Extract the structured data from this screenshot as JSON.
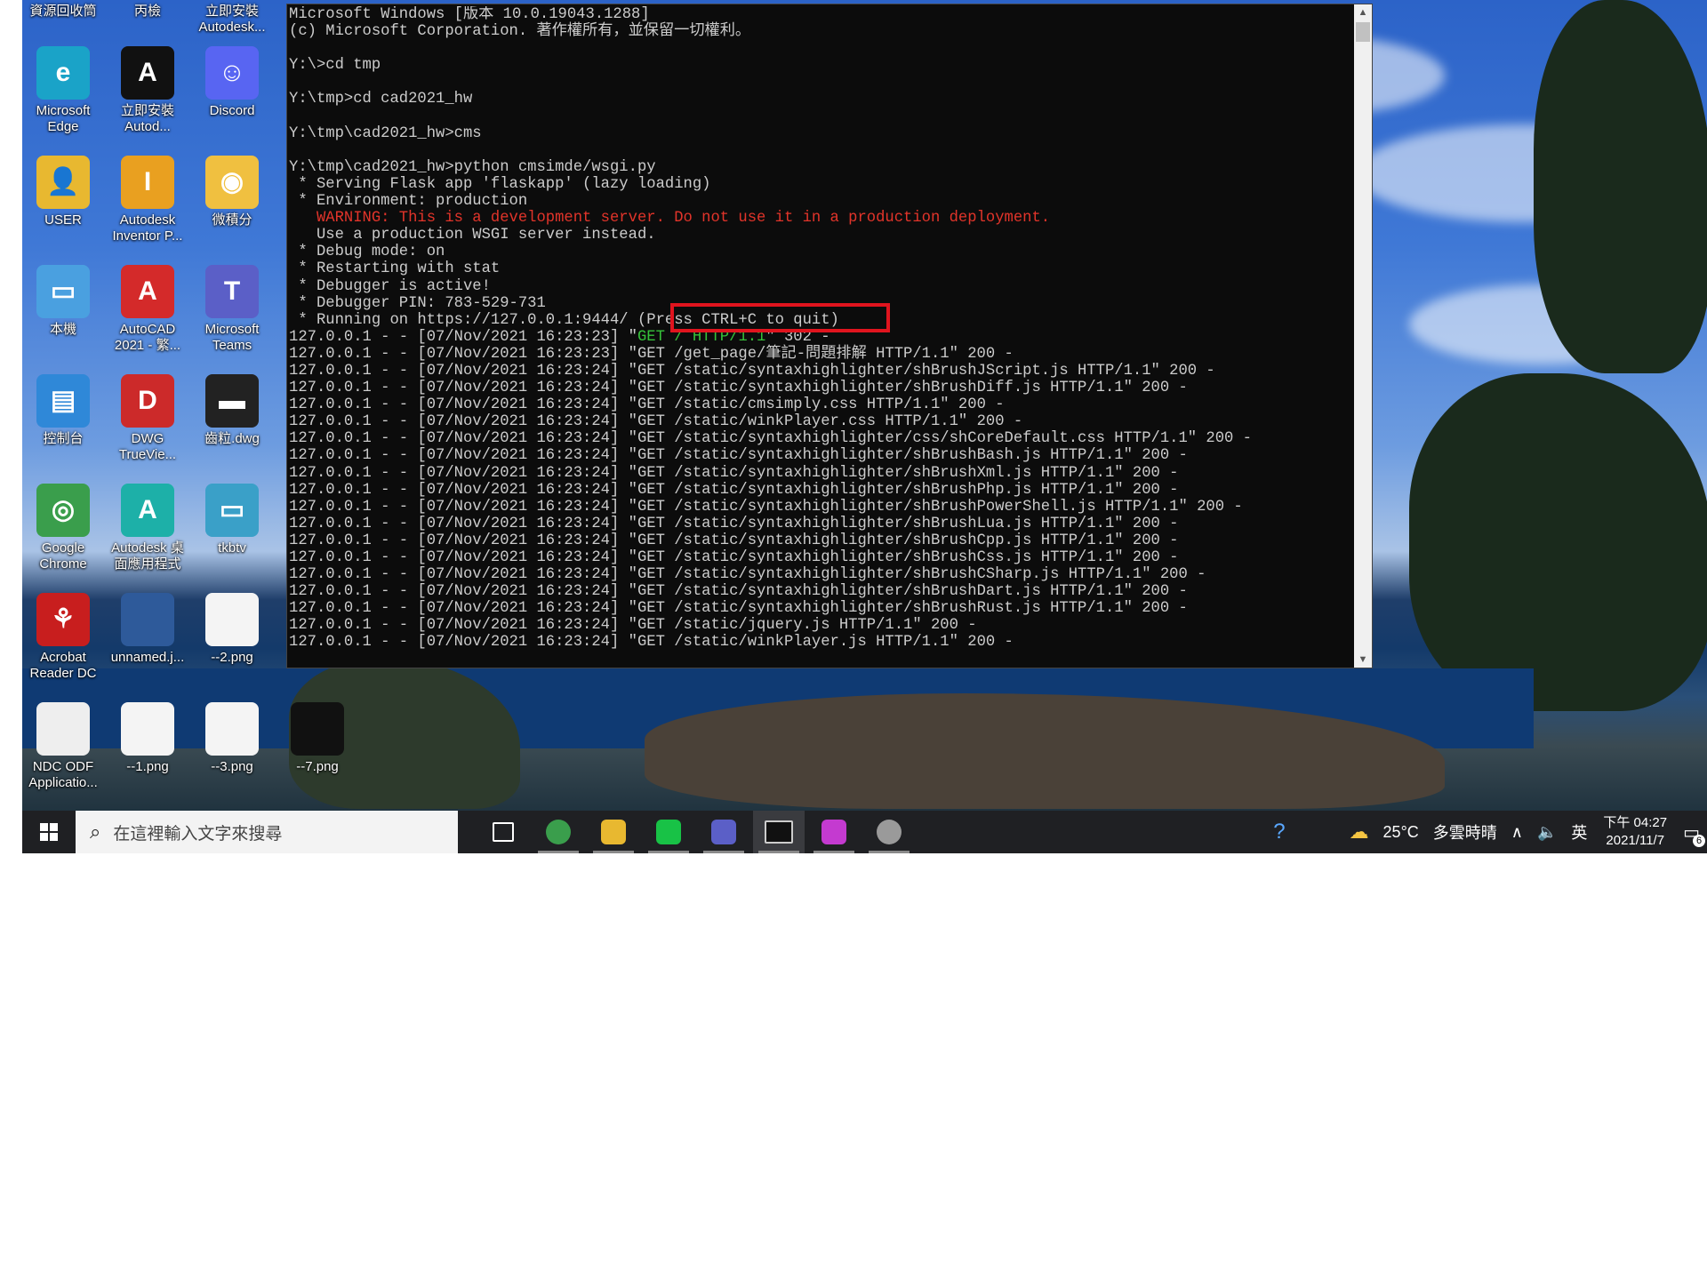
{
  "desktop_icons": [
    {
      "id": "recycle",
      "label": "資源回收筒",
      "color": "#6a8cad",
      "letter": ""
    },
    {
      "id": "c2",
      "label": "丙檢",
      "color": "#6a8cad",
      "letter": ""
    },
    {
      "id": "c3",
      "label": "立即安裝\nAutodesk...",
      "color": "#6a8cad",
      "letter": ""
    },
    {
      "id": "edge",
      "label": "Microsoft\nEdge",
      "color": "#1aa3c8",
      "letter": "e"
    },
    {
      "id": "autodesk-install",
      "label": "立即安裝\nAutod...",
      "color": "#111111",
      "letter": "A"
    },
    {
      "id": "discord",
      "label": "Discord",
      "color": "#5865f2",
      "letter": "☺"
    },
    {
      "id": "user",
      "label": "USER",
      "color": "#e8b830",
      "letter": "👤"
    },
    {
      "id": "inventor",
      "label": "Autodesk\nInventor P...",
      "color": "#e9a020",
      "letter": "I"
    },
    {
      "id": "weijifen",
      "label": "微積分",
      "color": "#f0c040",
      "letter": "◉"
    },
    {
      "id": "thispc",
      "label": "本機",
      "color": "#4aa0e0",
      "letter": "▭"
    },
    {
      "id": "autocad",
      "label": "AutoCAD\n2021 - 繁...",
      "color": "#d42a2a",
      "letter": "A"
    },
    {
      "id": "teams",
      "label": "Microsoft\nTeams",
      "color": "#5b5fc7",
      "letter": "T"
    },
    {
      "id": "control",
      "label": "控制台",
      "color": "#2f88d8",
      "letter": "▤"
    },
    {
      "id": "dwg",
      "label": "DWG\nTrueVie...",
      "color": "#cc2a2a",
      "letter": "D"
    },
    {
      "id": "dwgfile",
      "label": "齒粒.dwg",
      "color": "#222222",
      "letter": "▬"
    },
    {
      "id": "chrome",
      "label": "Google\nChrome",
      "color": "#3a9e4c",
      "letter": "◎"
    },
    {
      "id": "autodesk-app",
      "label": "Autodesk 桌\n面應用程式",
      "color": "#1db0a8",
      "letter": "A"
    },
    {
      "id": "tkbtv",
      "label": "tkbtv",
      "color": "#3aa0c8",
      "letter": "▭"
    },
    {
      "id": "acrobat",
      "label": "Acrobat\nReader DC",
      "color": "#c81e1e",
      "letter": "⚘"
    },
    {
      "id": "unnamed",
      "label": "unnamed.j...",
      "color": "#2e5a9a",
      "letter": ""
    },
    {
      "id": "png2",
      "label": "--2.png",
      "color": "#f4f4f4",
      "letter": ""
    },
    {
      "id": "ndc",
      "label": "NDC ODF\nApplicatio...",
      "color": "#eeeeee",
      "letter": ""
    },
    {
      "id": "png1",
      "label": "--1.png",
      "color": "#f4f4f4",
      "letter": ""
    },
    {
      "id": "png3",
      "label": "--3.png",
      "color": "#f4f4f4",
      "letter": ""
    },
    {
      "id": "png7",
      "label": "--7.png",
      "color": "#111111",
      "letter": ""
    }
  ],
  "cmd": {
    "lines": [
      {
        "t": "Microsoft Windows [版本 10.0.19043.1288]"
      },
      {
        "t": "(c) Microsoft Corporation. 著作權所有，並保留一切權利。"
      },
      {
        "t": ""
      },
      {
        "t": "Y:\\>cd tmp"
      },
      {
        "t": ""
      },
      {
        "t": "Y:\\tmp>cd cad2021_hw"
      },
      {
        "t": ""
      },
      {
        "t": "Y:\\tmp\\cad2021_hw>cms"
      },
      {
        "t": ""
      },
      {
        "t": "Y:\\tmp\\cad2021_hw>python cmsimde/wsgi.py"
      },
      {
        "t": " * Serving Flask app 'flaskapp' (lazy loading)"
      },
      {
        "t": " * Environment: production"
      },
      {
        "t": "   WARNING: This is a development server. Do not use it in a production deployment.",
        "c": "red"
      },
      {
        "t": "   Use a production WSGI server instead."
      },
      {
        "t": " * Debug mode: on"
      },
      {
        "t": " * Restarting with stat"
      },
      {
        "t": " * Debugger is active!"
      },
      {
        "t": " * Debugger PIN: 783-529-731"
      },
      {
        "t": " * Running on https://127.0.0.1:9444/ (Press CTRL+C to quit)"
      },
      {
        "t": "127.0.0.1 - - [07/Nov/2021 16:23:23] \"",
        "g": "GET / HTTP/1.1",
        "r": "\" 302 -"
      },
      {
        "t": "127.0.0.1 - - [07/Nov/2021 16:23:23] \"GET /get_page/筆記-問題排解 HTTP/1.1\" 200 -"
      },
      {
        "t": "127.0.0.1 - - [07/Nov/2021 16:23:24] \"GET /static/syntaxhighlighter/shBrushJScript.js HTTP/1.1\" 200 -"
      },
      {
        "t": "127.0.0.1 - - [07/Nov/2021 16:23:24] \"GET /static/syntaxhighlighter/shBrushDiff.js HTTP/1.1\" 200 -"
      },
      {
        "t": "127.0.0.1 - - [07/Nov/2021 16:23:24] \"GET /static/cmsimply.css HTTP/1.1\" 200 -"
      },
      {
        "t": "127.0.0.1 - - [07/Nov/2021 16:23:24] \"GET /static/winkPlayer.css HTTP/1.1\" 200 -"
      },
      {
        "t": "127.0.0.1 - - [07/Nov/2021 16:23:24] \"GET /static/syntaxhighlighter/css/shCoreDefault.css HTTP/1.1\" 200 -"
      },
      {
        "t": "127.0.0.1 - - [07/Nov/2021 16:23:24] \"GET /static/syntaxhighlighter/shBrushBash.js HTTP/1.1\" 200 -"
      },
      {
        "t": "127.0.0.1 - - [07/Nov/2021 16:23:24] \"GET /static/syntaxhighlighter/shBrushXml.js HTTP/1.1\" 200 -"
      },
      {
        "t": "127.0.0.1 - - [07/Nov/2021 16:23:24] \"GET /static/syntaxhighlighter/shBrushPhp.js HTTP/1.1\" 200 -"
      },
      {
        "t": "127.0.0.1 - - [07/Nov/2021 16:23:24] \"GET /static/syntaxhighlighter/shBrushPowerShell.js HTTP/1.1\" 200 -"
      },
      {
        "t": "127.0.0.1 - - [07/Nov/2021 16:23:24] \"GET /static/syntaxhighlighter/shBrushLua.js HTTP/1.1\" 200 -"
      },
      {
        "t": "127.0.0.1 - - [07/Nov/2021 16:23:24] \"GET /static/syntaxhighlighter/shBrushCpp.js HTTP/1.1\" 200 -"
      },
      {
        "t": "127.0.0.1 - - [07/Nov/2021 16:23:24] \"GET /static/syntaxhighlighter/shBrushCss.js HTTP/1.1\" 200 -"
      },
      {
        "t": "127.0.0.1 - - [07/Nov/2021 16:23:24] \"GET /static/syntaxhighlighter/shBrushCSharp.js HTTP/1.1\" 200 -"
      },
      {
        "t": "127.0.0.1 - - [07/Nov/2021 16:23:24] \"GET /static/syntaxhighlighter/shBrushDart.js HTTP/1.1\" 200 -"
      },
      {
        "t": "127.0.0.1 - - [07/Nov/2021 16:23:24] \"GET /static/syntaxhighlighter/shBrushRust.js HTTP/1.1\" 200 -"
      },
      {
        "t": "127.0.0.1 - - [07/Nov/2021 16:23:24] \"GET /static/jquery.js HTTP/1.1\" 200 -"
      },
      {
        "t": "127.0.0.1 - - [07/Nov/2021 16:23:24] \"GET /static/winkPlayer.js HTTP/1.1\" 200 -"
      }
    ]
  },
  "taskbar": {
    "search_placeholder": "在這裡輸入文字來搜尋",
    "apps": [
      {
        "id": "taskview",
        "color": "#1f2023",
        "active": false
      },
      {
        "id": "chrome",
        "color": "#3a9e4c",
        "active": false
      },
      {
        "id": "explorer",
        "color": "#e8b830",
        "active": false
      },
      {
        "id": "line",
        "color": "#18c246",
        "active": false
      },
      {
        "id": "teams",
        "color": "#5b5fc7",
        "active": false
      },
      {
        "id": "cmd",
        "color": "#111111",
        "active": true
      },
      {
        "id": "inventor",
        "color": "#c43ad0",
        "active": false
      },
      {
        "id": "globe",
        "color": "#9a9a9a",
        "active": false
      }
    ],
    "weather_temp": "25°C",
    "weather_text": "多雲時晴",
    "ime": "英",
    "clock_time": "下午 04:27",
    "clock_date": "2021/11/7",
    "notification_count": "6"
  }
}
